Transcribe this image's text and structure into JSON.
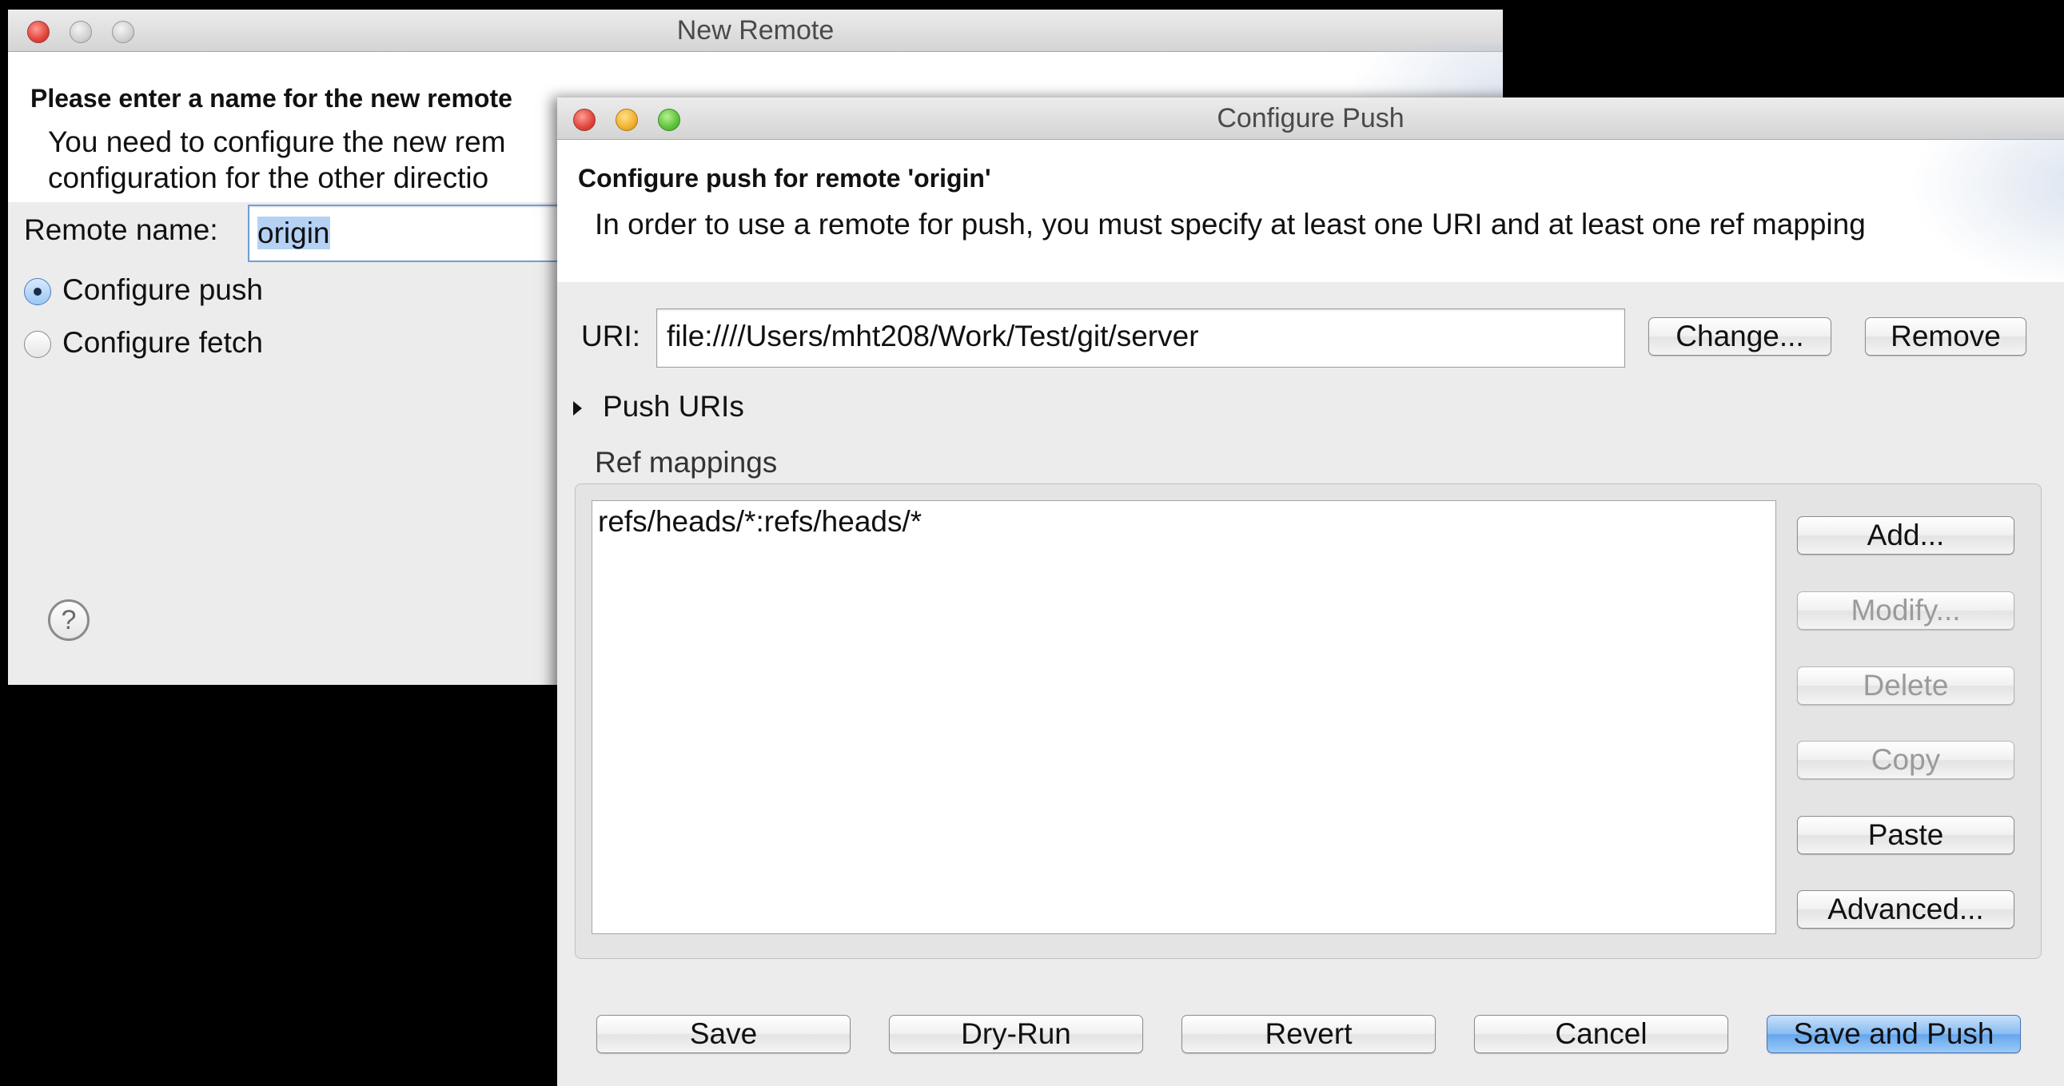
{
  "new_remote": {
    "title": "New Remote",
    "header_title": "Please enter a name for the new remote",
    "header_message_1": "You need to configure the new rem",
    "header_message_2": "configuration for the other directio",
    "remote_name_label": "Remote name:",
    "remote_name_value": "origin",
    "radio_push_label": "Configure push",
    "radio_fetch_label": "Configure fetch",
    "selected_option": "Configure push",
    "help_glyph": "?"
  },
  "configure_push": {
    "title": "Configure Push",
    "header_title": "Configure push for remote 'origin'",
    "header_message": "In order to use a remote for push, you must specify at least one URI and at least one ref mapping",
    "uri_label": "URI:",
    "uri_value": "file:////Users/mht208/Work/Test/git/server",
    "change_button": "Change...",
    "remove_button": "Remove",
    "push_uris_label": "Push URIs",
    "ref_mappings_label": "Ref mappings",
    "ref_mappings": [
      "refs/heads/*:refs/heads/*"
    ],
    "side_buttons": {
      "add": "Add...",
      "modify": "Modify...",
      "delete": "Delete",
      "copy": "Copy",
      "paste": "Paste",
      "advanced": "Advanced..."
    },
    "footer_buttons": {
      "save": "Save",
      "dry_run": "Dry-Run",
      "revert": "Revert",
      "cancel": "Cancel",
      "save_and_push": "Save and Push"
    }
  },
  "colors": {
    "background": "#000000",
    "window": "#ececec",
    "primary_button": "#64a6ee",
    "close_light": "#e0443b",
    "minimize_light": "#f1b02f",
    "zoom_light": "#5cc33a"
  },
  "icons": [
    "close-light",
    "minimize-light",
    "zoom-light",
    "expand-triangle-icon",
    "help-icon"
  ]
}
